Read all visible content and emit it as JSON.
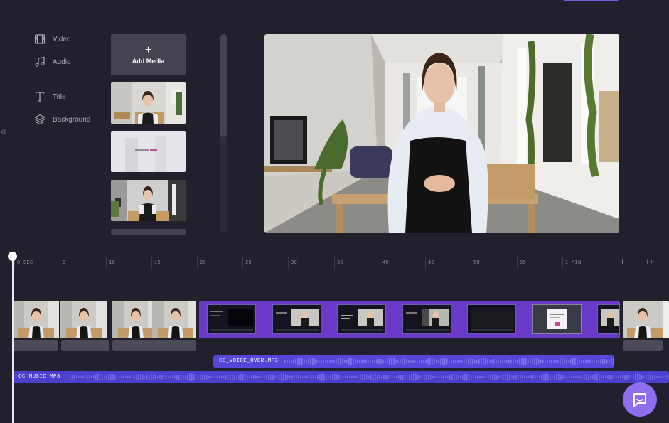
{
  "colors": {
    "bg": "#21202c",
    "accent": "#7b5ce0",
    "clip_purple": "#6b39c8",
    "audio_blue": "#5a4fe0"
  },
  "sidebar": {
    "items": [
      {
        "label": "Video",
        "icon": "film-icon"
      },
      {
        "label": "Audio",
        "icon": "music-note-icon"
      },
      {
        "label": "Title",
        "icon": "text-t-icon"
      },
      {
        "label": "Background",
        "icon": "layers-icon"
      }
    ]
  },
  "media": {
    "add_button": {
      "plus": "+",
      "label": "Add Media"
    },
    "tiles": [
      {
        "name": "woman-speaking-thumbnail"
      },
      {
        "name": "intro-title-thumbnail"
      },
      {
        "name": "woman-studio-thumbnail"
      }
    ]
  },
  "timeline": {
    "ticks": [
      "0 SEC",
      "5",
      "10",
      "15",
      "20",
      "25",
      "30",
      "35",
      "40",
      "45",
      "50",
      "55",
      "1 MIN"
    ],
    "controls": {
      "zoom_in": "+",
      "zoom_out": "−",
      "fit": "+⇠"
    },
    "tracks": {
      "voice_over": {
        "label": "CC_VOICE_OVER.MP3"
      },
      "music": {
        "label": "CC_MUSIC.MP3"
      }
    }
  },
  "chat": {
    "icon": "chat-bubble-icon"
  }
}
